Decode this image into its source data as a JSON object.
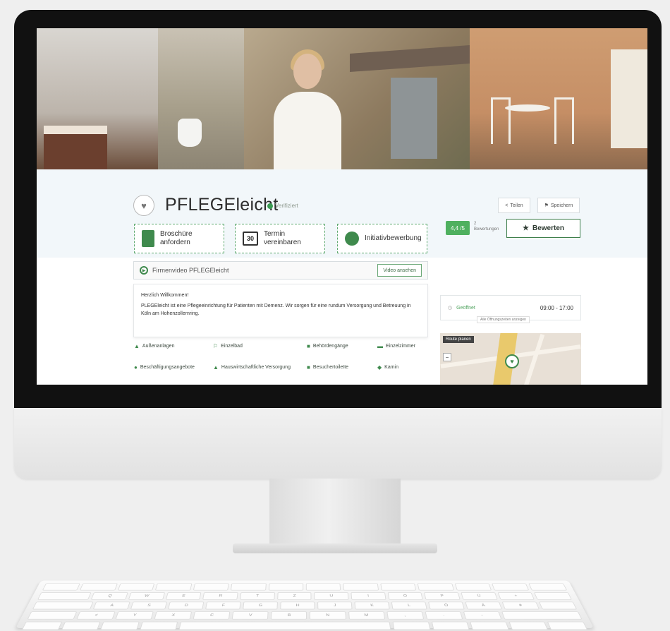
{
  "brand": {
    "name": "PFLEGEleicht",
    "verified_label": "Verifiziert",
    "icon": "hands-heart-icon"
  },
  "actions": [
    {
      "label": "Broschüre anfordern",
      "icon": "brochure-icon"
    },
    {
      "label": "Termin vereinbaren",
      "icon": "calendar-icon",
      "badge": "30"
    },
    {
      "label": "Initiativbewerbung",
      "icon": "application-icon"
    }
  ],
  "toolbar": {
    "share_label": "Teilen",
    "save_label": "Speichern"
  },
  "rating": {
    "score": "4,4 /5",
    "count": "2",
    "count_label": "Bewertungen",
    "rate_button": "Bewerten"
  },
  "video": {
    "label": "Firmenvideo PFLEGEleicht",
    "button": "Video ansehen"
  },
  "welcome": {
    "greeting": "Herzlich Willkommen!",
    "body": "PLEGEleicht ist eine Pflegeeinrichtung für Patienten mit Demenz. Wir sorgen für eine rundum Versorgung und Betreuung in Köln am Hohenzollernring."
  },
  "amenities": [
    {
      "label": "Außenanlagen",
      "icon": "tree-icon"
    },
    {
      "label": "Einzelbad",
      "icon": "shower-icon"
    },
    {
      "label": "Behördengänge",
      "icon": "truck-icon"
    },
    {
      "label": "Einzelzimmer",
      "icon": "bed-icon"
    },
    {
      "label": "Beschäftigungsangebote",
      "icon": "activity-icon"
    },
    {
      "label": "Hauswirtschaftliche Versorgung",
      "icon": "spray-icon"
    },
    {
      "label": "Besuchertoilette",
      "icon": "toilet-icon"
    },
    {
      "label": "Kamin",
      "icon": "fire-icon"
    }
  ],
  "hours": {
    "status": "Geöffnet",
    "time": "09:00 - 17:00",
    "note": "Alle Öffnungszeiten anzeigen"
  },
  "map": {
    "route_label": "Route planen",
    "zoom_out": "−"
  },
  "keyboard_rows": [
    [
      "",
      "",
      "",
      "",
      "",
      "",
      "",
      "",
      "",
      "",
      "",
      "",
      "",
      ""
    ],
    [
      "",
      "Q",
      "W",
      "E",
      "R",
      "T",
      "Z",
      "U",
      "I",
      "O",
      "P",
      "Ü",
      "+",
      ""
    ],
    [
      "",
      "A",
      "S",
      "D",
      "F",
      "G",
      "H",
      "J",
      "K",
      "L",
      "Ö",
      "Ä",
      "#",
      ""
    ],
    [
      "",
      "<",
      "Y",
      "X",
      "C",
      "V",
      "B",
      "N",
      "M",
      ",",
      ".",
      "-",
      ""
    ],
    [
      "",
      "",
      "",
      "",
      "",
      "",
      "",
      "",
      "",
      ""
    ]
  ],
  "colors": {
    "accent": "#3f8a4d",
    "rating": "#4fb05f",
    "band": "#f2f7fa"
  }
}
